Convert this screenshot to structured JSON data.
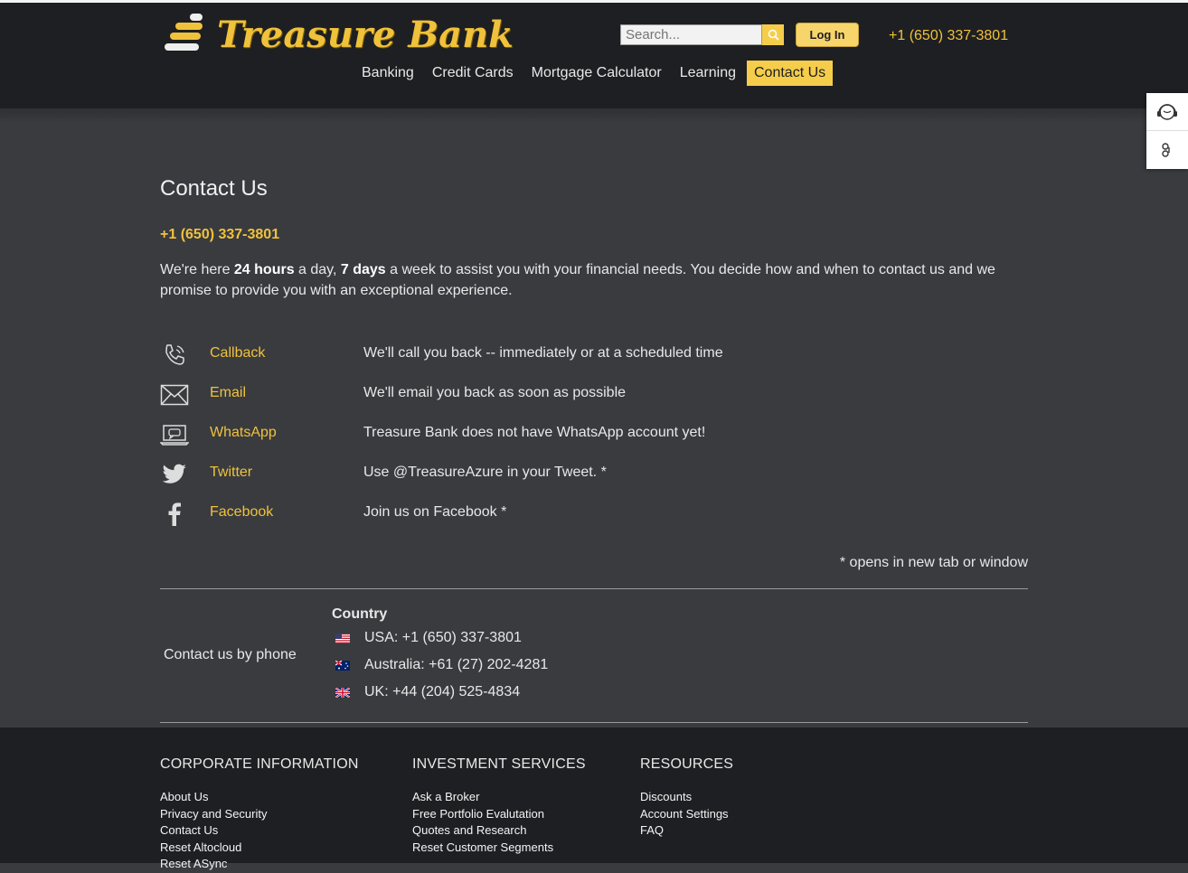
{
  "brand": {
    "name": "Treasure Bank"
  },
  "header": {
    "search_placeholder": "Search...",
    "login_label": "Log In",
    "phone": "+1 (650) 337-3801"
  },
  "nav": {
    "items": [
      {
        "label": "Banking"
      },
      {
        "label": "Credit Cards"
      },
      {
        "label": "Mortgage Calculator"
      },
      {
        "label": "Learning"
      },
      {
        "label": "Contact Us",
        "active": true
      }
    ]
  },
  "main": {
    "title": "Contact Us",
    "phone": "+1 (650) 337-3801",
    "intro": {
      "p1": "We're here ",
      "b1": "24 hours",
      "p2": " a day, ",
      "b2": "7 days",
      "p3": " a week to assist you with your financial needs. You decide how and when to contact us and we promise to provide you with an exceptional experience."
    },
    "methods": [
      {
        "icon": "phone-callback-icon",
        "label": "Callback",
        "desc": "We'll call you back -- immediately or at a scheduled time"
      },
      {
        "icon": "envelope-icon",
        "label": "Email",
        "desc": "We'll email you back as soon as possible"
      },
      {
        "icon": "laptop-chat-icon",
        "label": "WhatsApp",
        "desc": "Treasure Bank does not have WhatsApp account yet!"
      },
      {
        "icon": "twitter-bird-icon",
        "label": "Twitter",
        "desc": "Use @TreasureAzure in your Tweet. *"
      },
      {
        "icon": "facebook-f-icon",
        "label": "Facebook",
        "desc": "Join us on Facebook *"
      }
    ],
    "note": "* opens in new tab or window",
    "phone_section": {
      "label": "Contact us by phone",
      "country_header": "Country",
      "rows": [
        {
          "flag": "us-flag-icon",
          "text": "USA: +1 (650) 337-3801"
        },
        {
          "flag": "au-flag-icon",
          "text": "Australia: +61 (27) 202-4281"
        },
        {
          "flag": "uk-flag-icon",
          "text": "UK: +44 (204) 525-4834"
        }
      ]
    }
  },
  "footer": {
    "columns": [
      {
        "title": "CORPORATE INFORMATION",
        "links": [
          "About Us",
          "Privacy and Security",
          "Contact Us",
          "Reset Altocloud",
          "Reset ASync"
        ]
      },
      {
        "title": "INVESTMENT SERVICES",
        "links": [
          "Ask a Broker",
          "Free Portfolio Evalutation",
          "Quotes and Research",
          "Reset Customer Segments"
        ]
      },
      {
        "title": "RESOURCES",
        "links": [
          "Discounts",
          "Account Settings",
          "FAQ"
        ]
      }
    ]
  },
  "colors": {
    "accent": "#f0c13b",
    "header_bg": "#1e1f22",
    "page_bg": "#393b3f"
  }
}
